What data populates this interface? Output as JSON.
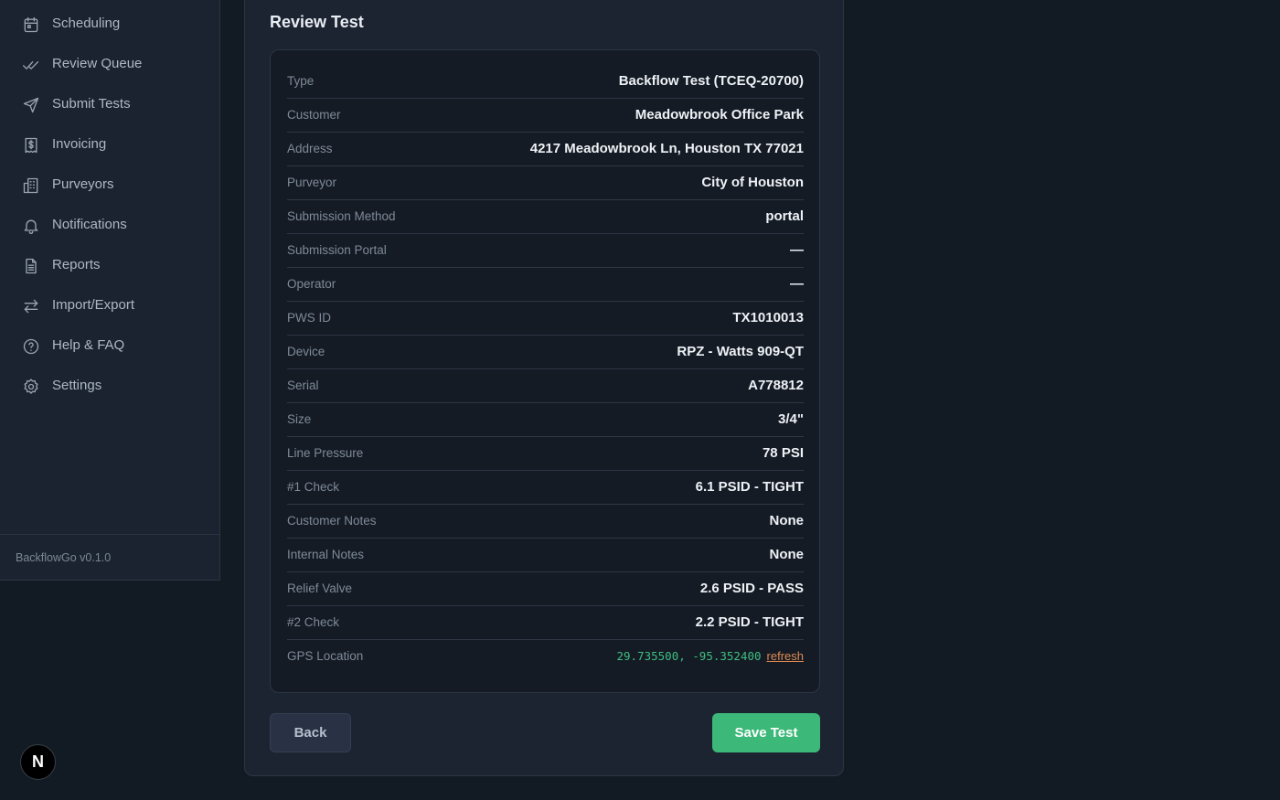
{
  "sidebar": {
    "items": [
      {
        "label": "Scheduling",
        "icon": "calendar-icon"
      },
      {
        "label": "Review Queue",
        "icon": "double-check-icon"
      },
      {
        "label": "Submit Tests",
        "icon": "send-icon"
      },
      {
        "label": "Invoicing",
        "icon": "receipt-icon"
      },
      {
        "label": "Purveyors",
        "icon": "building-icon"
      },
      {
        "label": "Notifications",
        "icon": "bell-icon"
      },
      {
        "label": "Reports",
        "icon": "document-icon"
      },
      {
        "label": "Import/Export",
        "icon": "arrows-exchange-icon"
      },
      {
        "label": "Help & FAQ",
        "icon": "help-circle-icon"
      },
      {
        "label": "Settings",
        "icon": "gear-icon"
      }
    ],
    "version": "BackflowGo v0.1.0"
  },
  "badge": {
    "letter": "N"
  },
  "panel": {
    "title": "Review Test",
    "fields": [
      {
        "key": "Type",
        "value": "Backflow Test (TCEQ-20700)"
      },
      {
        "key": "Customer",
        "value": "Meadowbrook Office Park"
      },
      {
        "key": "Address",
        "value": "4217 Meadowbrook Ln, Houston TX 77021"
      },
      {
        "key": "Purveyor",
        "value": "City of Houston"
      },
      {
        "key": "Submission Method",
        "value": "portal"
      },
      {
        "key": "Submission Portal",
        "value": "—"
      },
      {
        "key": "Operator",
        "value": "—"
      },
      {
        "key": "PWS ID",
        "value": "TX1010013"
      },
      {
        "key": "Device",
        "value": "RPZ - Watts 909-QT"
      },
      {
        "key": "Serial",
        "value": "A778812"
      },
      {
        "key": "Size",
        "value": "3/4\""
      },
      {
        "key": "Line Pressure",
        "value": "78 PSI"
      },
      {
        "key": "#1 Check",
        "value": "6.1 PSID - TIGHT"
      },
      {
        "key": "Customer Notes",
        "value": "None"
      },
      {
        "key": "Internal Notes",
        "value": "None"
      },
      {
        "key": "Relief Valve",
        "value": "2.6 PSID - PASS"
      },
      {
        "key": "#2 Check",
        "value": "2.2 PSID - TIGHT"
      }
    ],
    "gps": {
      "key": "GPS Location",
      "coords": "29.735500, -95.352400",
      "refresh_label": "refresh"
    },
    "back_label": "Back",
    "save_label": "Save Test"
  },
  "colors": {
    "accent": "#3cb878",
    "link": "#e0894f",
    "background": "#121a23"
  }
}
